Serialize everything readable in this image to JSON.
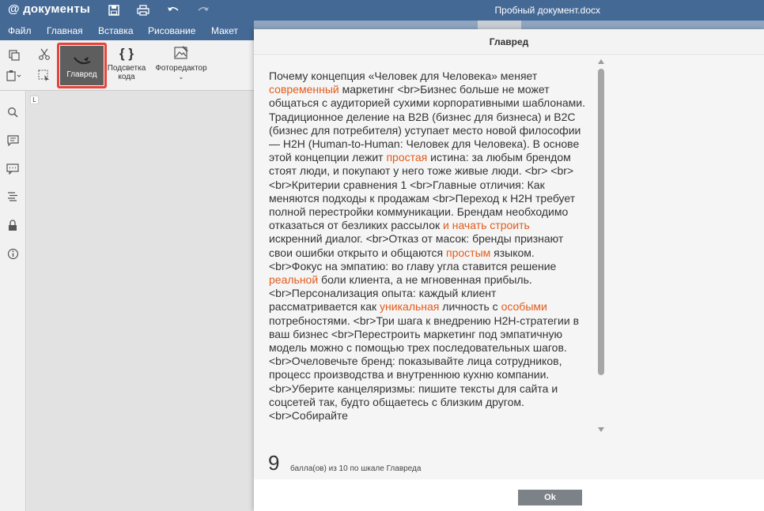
{
  "app": {
    "logo_at": "@",
    "logo_text": "документы",
    "doc_title": "Пробный документ.docx"
  },
  "menu": [
    "Файл",
    "Главная",
    "Вставка",
    "Рисование",
    "Макет"
  ],
  "toolbar": {
    "glavred_label": "Главред",
    "highlight_label_1": "Подсветка",
    "highlight_label_2": "кода",
    "photo_label": "Фоторедактор",
    "braces": "{ }"
  },
  "icons": [
    "save-icon",
    "print-icon",
    "undo-icon",
    "redo-icon",
    "copy-icon",
    "paste-icon",
    "cut-icon",
    "select-icon",
    "search-icon",
    "comment-icon",
    "chat-icon",
    "navigation-icon",
    "lock-icon",
    "info-icon"
  ],
  "ruler_corner": "L",
  "modal": {
    "title": "Главред",
    "segments": [
      {
        "t": "Почему концепция «Человек для Человека» меняет ",
        "h": false
      },
      {
        "t": "современный",
        "h": true
      },
      {
        "t": " маркетинг <br>Бизнес больше не может общаться с аудиторией сухими корпоративными шаблонами. Традиционное деление на B2B (бизнес для бизнеса) и B2C (бизнес для потребителя) уступает место новой философии — H2H (Human-to-Human: Человек для Человека). В основе этой концепции лежит ",
        "h": false
      },
      {
        "t": "простая",
        "h": true
      },
      {
        "t": " истина: за любым брендом стоят люди, и покупают у него тоже живые люди. <br> <br> <br>Критерии сравнения 1 <br>Главные отличия: Как меняются подходы к продажам <br>Переход к H2H требует полной перестройки коммуникации. Брендам необходимо отказаться от безликих рассылок ",
        "h": false
      },
      {
        "t": "и начать строить",
        "h": true
      },
      {
        "t": " искренний диалог. <br>Отказ от масок: бренды признают свои ошибки открыто и общаются ",
        "h": false
      },
      {
        "t": "простым",
        "h": true
      },
      {
        "t": " языком. <br>Фокус на эмпатию: во главу угла ставится решение ",
        "h": false
      },
      {
        "t": "реальной",
        "h": true
      },
      {
        "t": " боли клиента, а не мгновенная прибыль. <br>Персонализация опыта: каждый клиент рассматривается как ",
        "h": false
      },
      {
        "t": "уникальная",
        "h": true
      },
      {
        "t": " личность с ",
        "h": false
      },
      {
        "t": "особыми",
        "h": true
      },
      {
        "t": " потребностями. <br>Три шага к внедрению H2H-стратегии в ваш бизнес <br>Перестроить маркетинг под эмпатичную модель можно с помощью трех последовательных шагов. <br>Очеловечьте бренд: показывайте лица сотрудников, процесс производства и внутреннюю кухню компании. <br>Уберите канцеляризмы: пишите тексты для сайта и соцсетей так, будто общаетесь с близким другом. <br>Собирайте",
        "h": false
      }
    ],
    "score": "9",
    "score_text": "балла(ов) из 10 по шкале Главреда",
    "ok_label": "Ok"
  },
  "colors": {
    "header": "#446995",
    "highlight": "#e35b1b",
    "active_tool": "#5e5e5e",
    "callout": "#e8423a"
  }
}
